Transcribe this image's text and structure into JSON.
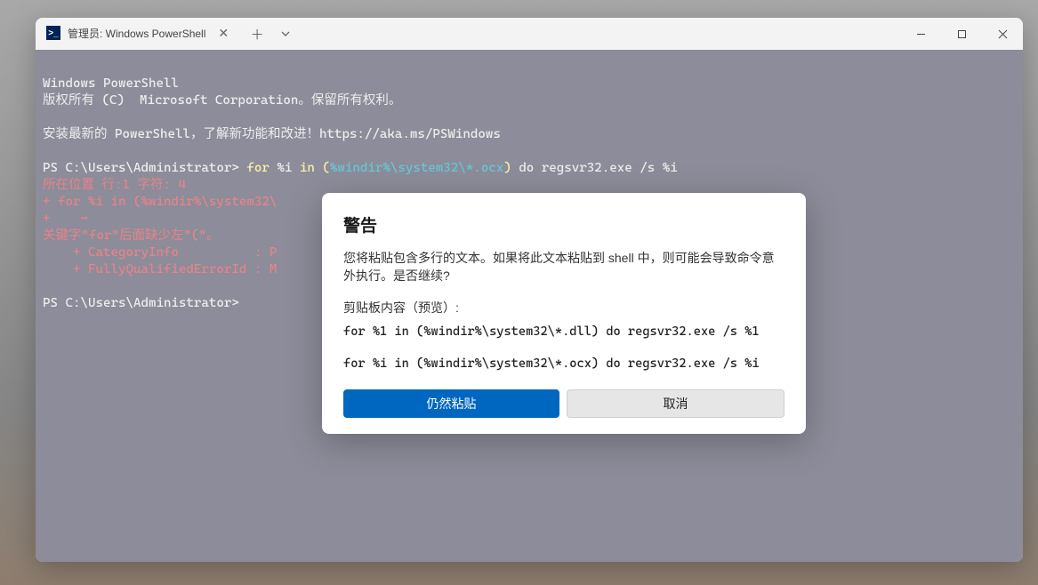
{
  "tab": {
    "title": "管理员: Windows PowerShell"
  },
  "terminal": {
    "l1": "Windows PowerShell",
    "l2": "版权所有 (C)  Microsoft Corporation。保留所有权利。",
    "l3": "",
    "l4": "安装最新的 PowerShell，了解新功能和改进！https://aka.ms/PSWindows",
    "l5": "",
    "prompt1a": "PS C:\\Users\\Administrator> ",
    "prompt1b": "for ",
    "prompt1c": "%i ",
    "prompt1d": "in ",
    "prompt1e": "(",
    "prompt1f": "%windir%\\system32\\*.ocx",
    "prompt1g": ") ",
    "prompt1h": "do regsvr32.exe /s %i",
    "err1": "所在位置 行:1 字符: 4",
    "err2": "+ for %i in (%windir%\\system32\\",
    "err3": "+    ~",
    "err4": "关键字\"for\"后面缺少左\"(\"。",
    "err5": "    + CategoryInfo          : P",
    "err6": "    + FullyQualifiedErrorId : M",
    "prompt2": "PS C:\\Users\\Administrator>"
  },
  "dialog": {
    "title": "警告",
    "body": "您将粘贴包含多行的文本。如果将此文本粘贴到 shell 中，则可能会导致命令意外执行。是否继续?",
    "previewLabel": "剪贴板内容（预览）:",
    "preview1": "for %1 in (%windir%\\system32\\*.dll) do regsvr32.exe /s %1",
    "preview2": "for %i in (%windir%\\system32\\*.ocx) do regsvr32.exe /s %i",
    "primaryBtn": "仍然粘贴",
    "secondaryBtn": "取消"
  }
}
